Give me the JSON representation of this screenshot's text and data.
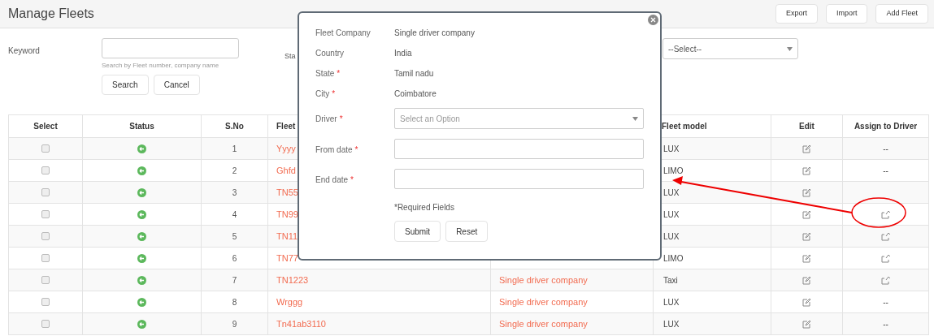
{
  "header": {
    "title": "Manage Fleets",
    "buttons": [
      "Export",
      "Import",
      "Add Fleet"
    ]
  },
  "filters": {
    "keyword_label": "Keyword",
    "keyword_hint": "Search by Fleet number, company name",
    "buttons": [
      "Search",
      "Cancel"
    ],
    "second_label": "Sta",
    "select_value": "--Select--"
  },
  "table": {
    "columns": [
      "Select",
      "Status",
      "S.No",
      "Fleet",
      "",
      "Fleet model",
      "Edit",
      "Assign to Driver"
    ],
    "rows": [
      {
        "checked": false,
        "sno": "1",
        "fleet": "Yyyy",
        "company": "",
        "model": "LUX",
        "assign": {
          "kind": "text",
          "text": "--"
        }
      },
      {
        "checked": false,
        "sno": "2",
        "fleet": "Ghfd",
        "company": "",
        "model": "LIMO",
        "assign": {
          "kind": "text",
          "text": "--"
        }
      },
      {
        "checked": false,
        "sno": "3",
        "fleet": "TN55",
        "company": "",
        "model": "LUX",
        "assign": {
          "kind": "none"
        }
      },
      {
        "checked": false,
        "sno": "4",
        "fleet": "TN99",
        "company": "",
        "model": "LUX",
        "assign": {
          "kind": "icon"
        }
      },
      {
        "checked": false,
        "sno": "5",
        "fleet": "TN11",
        "company": "",
        "model": "LUX",
        "assign": {
          "kind": "icon"
        }
      },
      {
        "checked": false,
        "sno": "6",
        "fleet": "TN77",
        "company": "",
        "model": "LIMO",
        "assign": {
          "kind": "icon"
        }
      },
      {
        "checked": false,
        "sno": "7",
        "fleet": "TN1223",
        "company": "Single driver company",
        "model": "Taxi",
        "assign": {
          "kind": "icon"
        }
      },
      {
        "checked": false,
        "sno": "8",
        "fleet": "Wrggg",
        "company": "Single driver company",
        "model": "LUX",
        "assign": {
          "kind": "text",
          "text": "--"
        }
      },
      {
        "checked": false,
        "sno": "9",
        "fleet": "Tn41ab3110",
        "company": "Single driver company",
        "model": "LUX",
        "assign": {
          "kind": "text",
          "text": "--"
        }
      }
    ]
  },
  "modal": {
    "fields": [
      {
        "kind": "text",
        "label": "Fleet Company",
        "value": "Single driver company"
      },
      {
        "kind": "text",
        "label": "Country",
        "value": "India"
      },
      {
        "kind": "text",
        "label": "State",
        "required_mark": "*",
        "value": "Tamil nadu"
      },
      {
        "kind": "text",
        "label": "City",
        "required_mark": "*",
        "value": "Coimbatore"
      },
      {
        "kind": "select",
        "label": "Driver",
        "required_mark": "*",
        "placeholder": "Select an Option"
      },
      {
        "kind": "input",
        "label": "From date",
        "required_mark": "*"
      },
      {
        "kind": "input",
        "label": "End date",
        "required_mark": "*"
      }
    ],
    "note": "*Required Fields",
    "buttons": [
      "Submit",
      "Reset"
    ]
  }
}
